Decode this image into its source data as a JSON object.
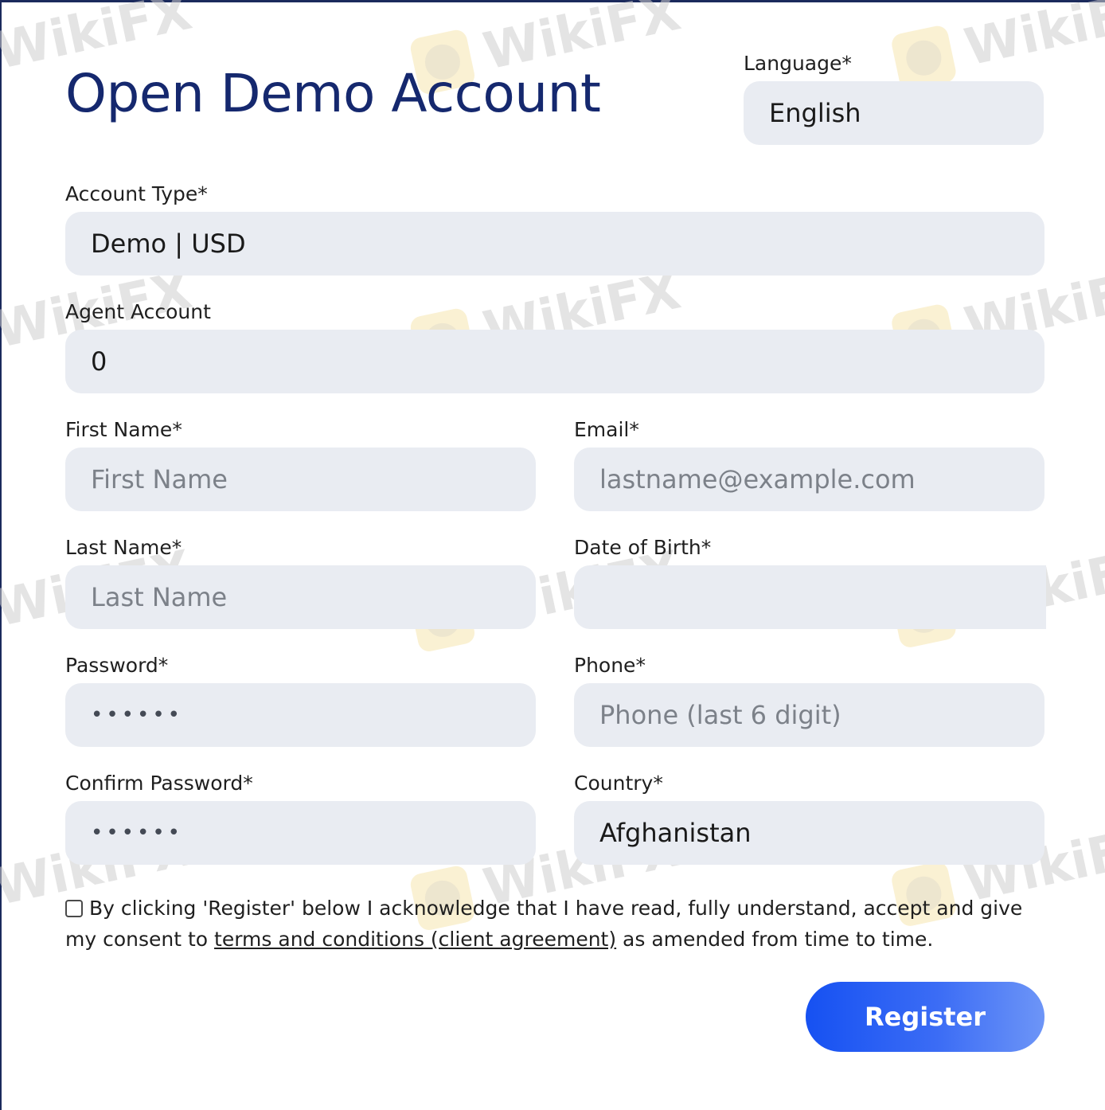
{
  "header": {
    "title": "Open Demo Account"
  },
  "language": {
    "label": "Language*",
    "value": "English"
  },
  "account_type": {
    "label": "Account Type*",
    "value": "Demo | USD"
  },
  "agent_account": {
    "label": "Agent Account",
    "value": "0"
  },
  "first_name": {
    "label": "First Name*",
    "placeholder": "First Name"
  },
  "email": {
    "label": "Email*",
    "placeholder": "lastname@example.com"
  },
  "last_name": {
    "label": "Last Name*",
    "placeholder": "Last Name"
  },
  "date_of_birth": {
    "label": "Date of Birth*",
    "value": ""
  },
  "password": {
    "label": "Password*",
    "value": "••••••"
  },
  "phone": {
    "label": "Phone*",
    "placeholder": "Phone (last 6 digit)"
  },
  "confirm_password": {
    "label": "Confirm Password*",
    "value": "••••••"
  },
  "country": {
    "label": "Country*",
    "value": "Afghanistan"
  },
  "consent": {
    "checked": false,
    "text_before": "By clicking 'Register' below I acknowledge that I have read, fully understand, accept and give my consent to ",
    "link_text": "terms and conditions (client agreement)",
    "text_after": " as amended from time to time."
  },
  "actions": {
    "register_label": "Register"
  },
  "colors": {
    "title": "#15286e",
    "field_bg": "#e9ecf2",
    "button_start": "#1651f2",
    "button_end": "#6d95f7"
  }
}
